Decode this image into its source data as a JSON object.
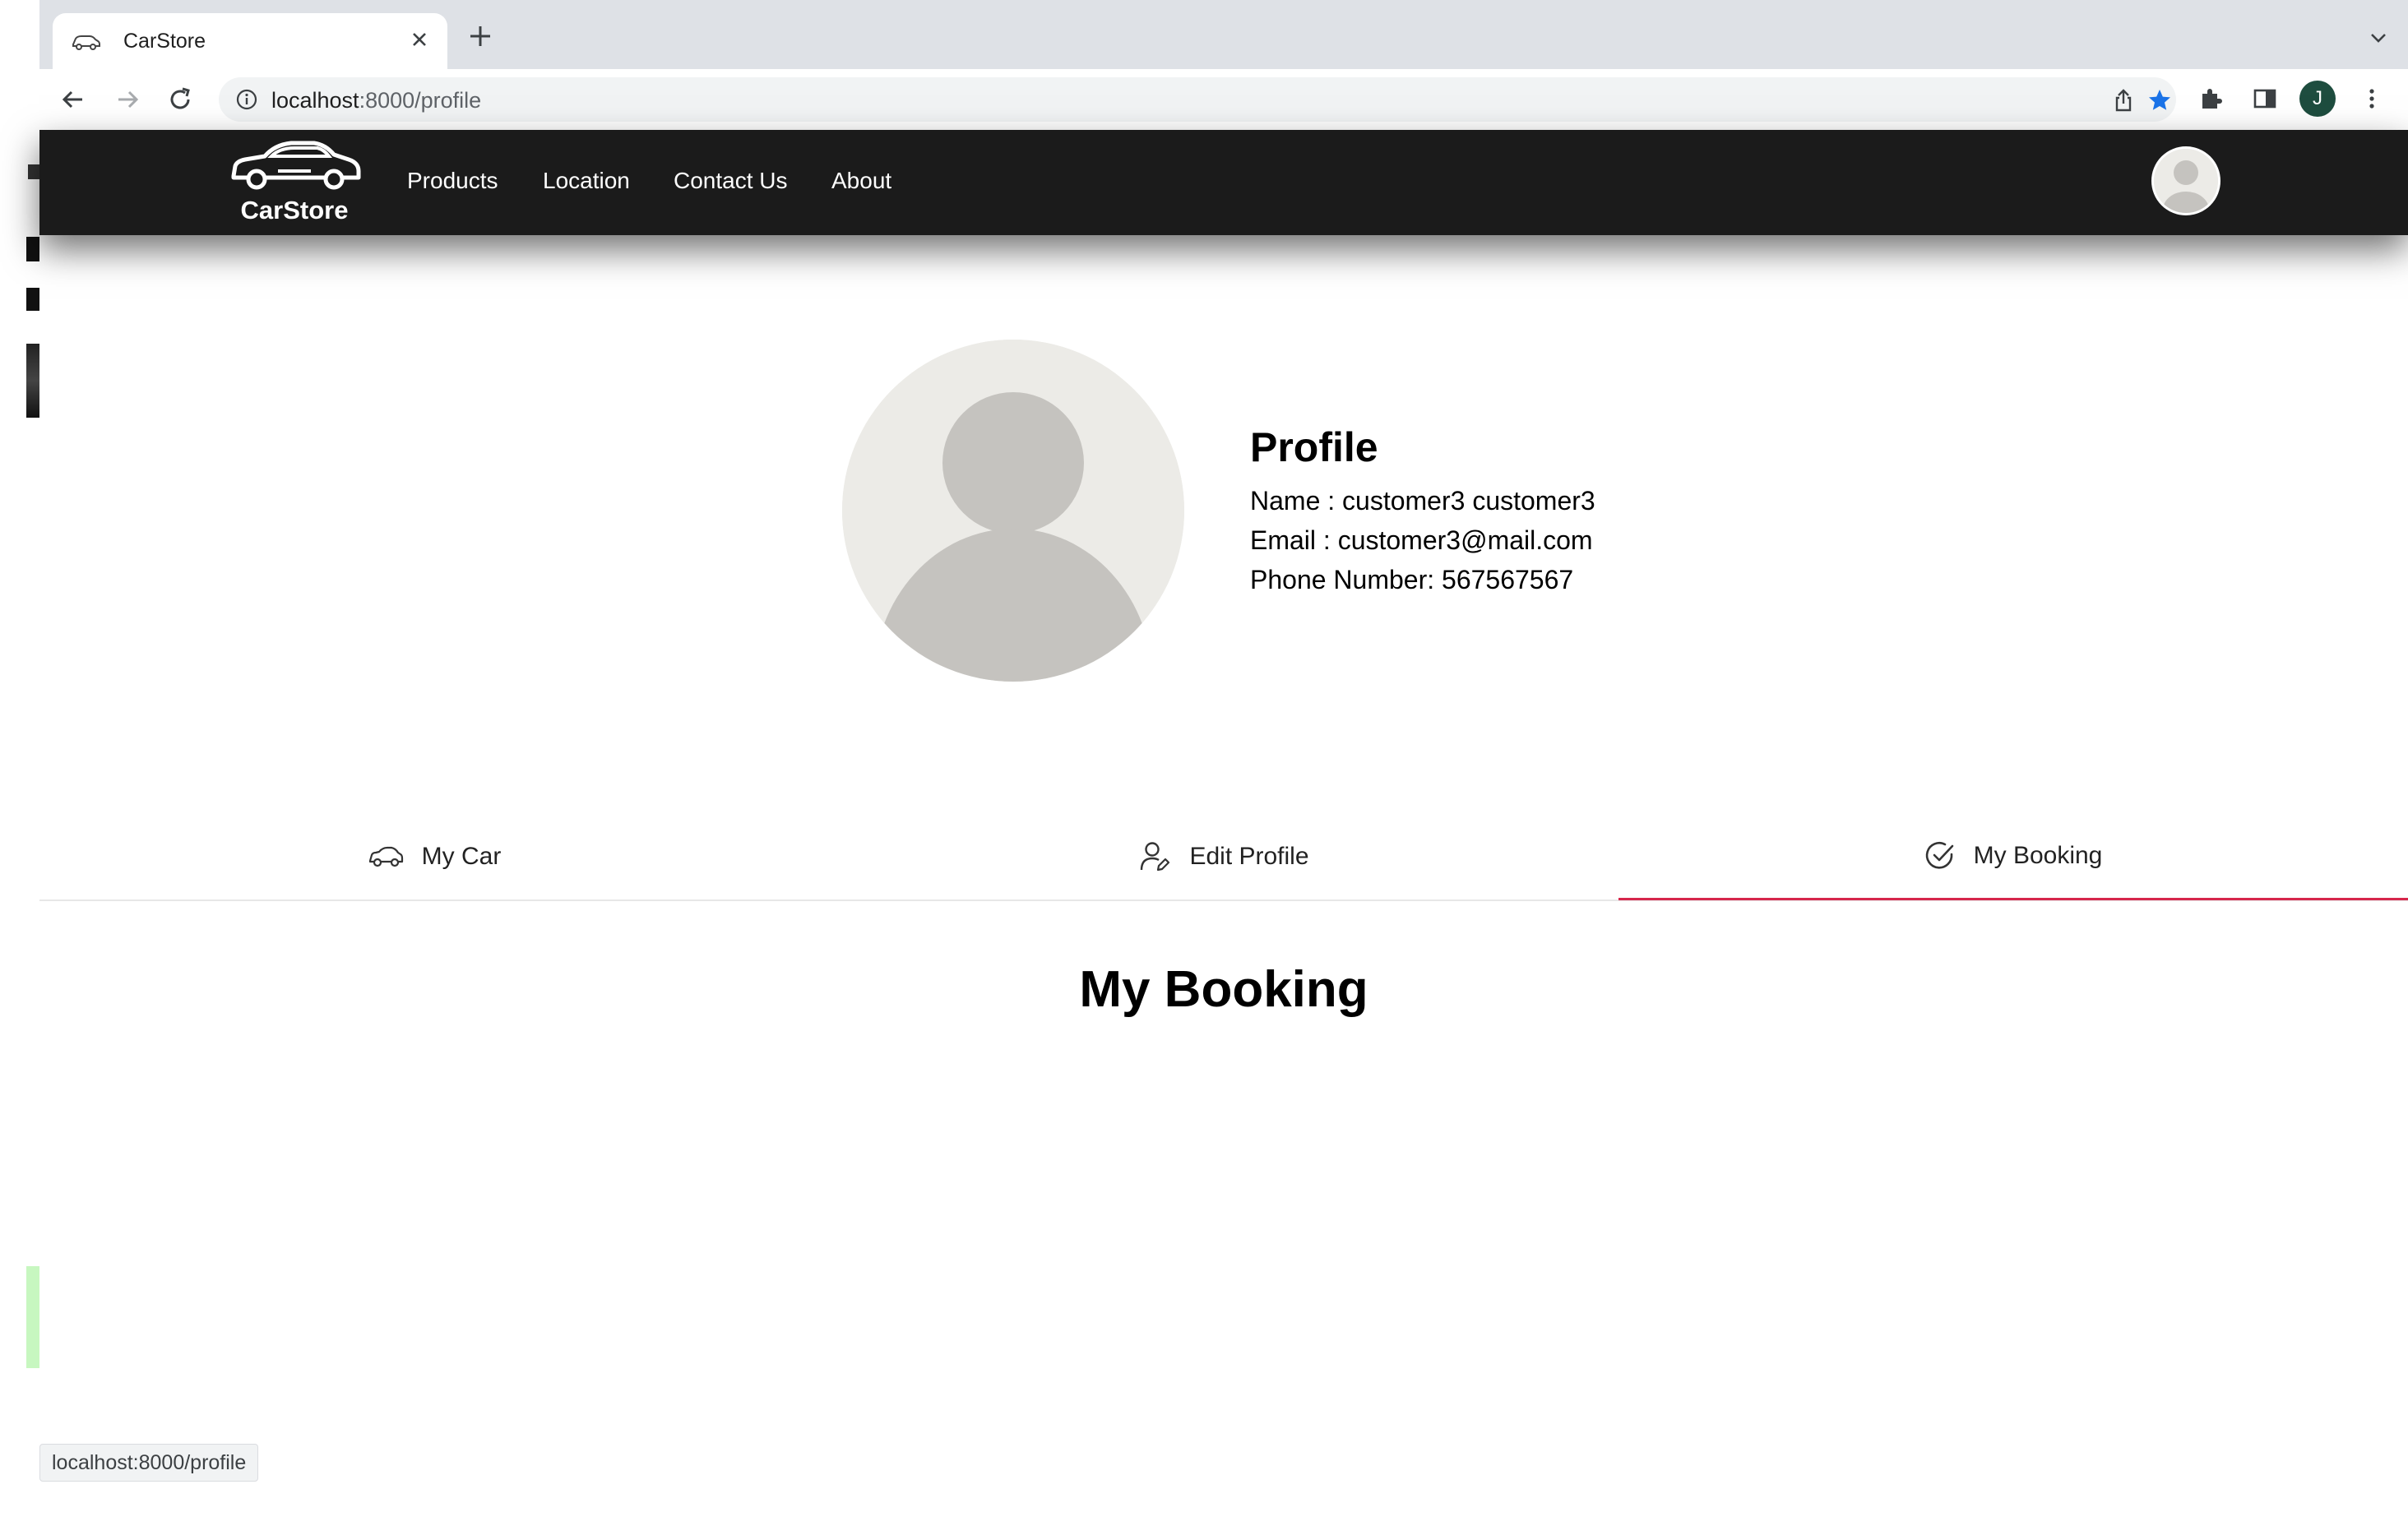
{
  "browser": {
    "tab_title": "CarStore",
    "url_host": "localhost",
    "url_path": ":8000/profile",
    "profile_initial": "J",
    "status_url": "localhost:8000/profile"
  },
  "site": {
    "brand": "CarStore",
    "nav": [
      "Products",
      "Location",
      "Contact Us",
      "About"
    ]
  },
  "profile": {
    "heading": "Profile",
    "name_line": "Name : customer3 customer3",
    "email_line": "Email : customer3@mail.com",
    "phone_line": "Phone Number: 567567567"
  },
  "tabs": [
    {
      "label": "My Car",
      "icon": "car-icon",
      "active": false
    },
    {
      "label": "Edit Profile",
      "icon": "user-edit-icon",
      "active": false
    },
    {
      "label": "My Booking",
      "icon": "check-circle-icon",
      "active": true
    }
  ],
  "section": {
    "title": "My Booking"
  },
  "colors": {
    "navbar_bg": "#1b1b1b",
    "active_tab_underline": "#d6264b",
    "bookmark_star": "#1a73e8",
    "avatar_bg": "#ecebe7",
    "avatar_figure": "#c5c3bf"
  }
}
